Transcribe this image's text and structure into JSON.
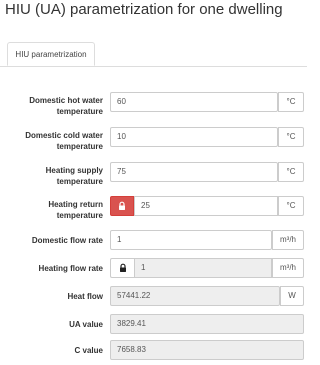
{
  "page": {
    "title": "HIU (UA) parametrization for one dwelling"
  },
  "tabs": [
    {
      "label": "HIU parametrization"
    }
  ],
  "fields": {
    "dhw_temp": {
      "label": "Domestic hot water temperature",
      "value": "60",
      "unit": "°C"
    },
    "dcw_temp": {
      "label": "Domestic cold water temperature",
      "value": "10",
      "unit": "°C"
    },
    "heating_supply": {
      "label": "Heating supply temperature",
      "value": "75",
      "unit": "°C"
    },
    "heating_return": {
      "label": "Heating return temperature",
      "value": "25",
      "unit": "°C",
      "locked": true,
      "lock_color": "#d9534f"
    },
    "domestic_flow": {
      "label": "Domestic flow rate",
      "value": "1",
      "unit": "m³/h"
    },
    "heating_flow": {
      "label": "Heating flow rate",
      "value": "1",
      "unit": "m³/h",
      "locked": true
    },
    "heat_flow": {
      "label": "Heat flow",
      "value": "57441.22",
      "unit": "W"
    },
    "ua_value": {
      "label": "UA value",
      "value": "3829.41"
    },
    "c_value": {
      "label": "C value",
      "value": "7658.83"
    }
  }
}
